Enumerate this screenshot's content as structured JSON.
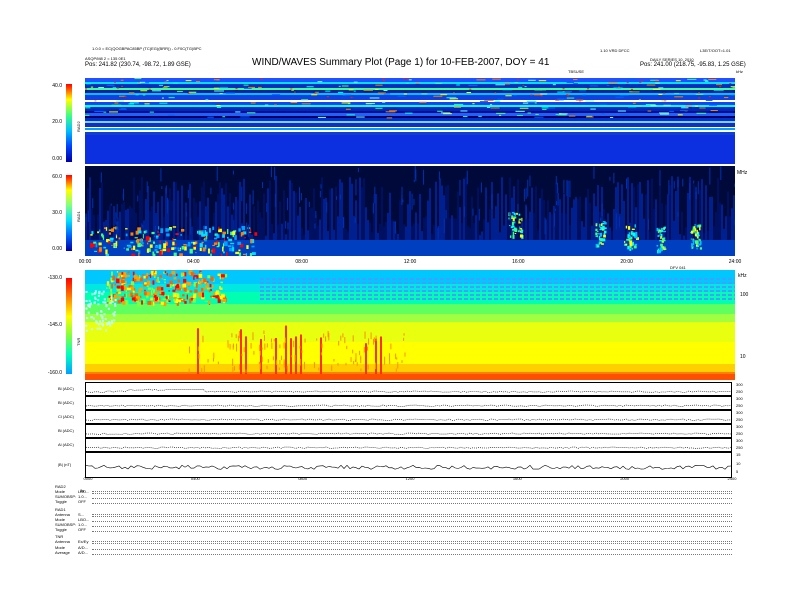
{
  "header": {
    "left_line1": "1.0.0 = EC(QOGBPAC85BP (TC(EG)(BRR)) - 0.F0C(TG)BPC",
    "left_line2": "ASQP/M8 2 = 135 0E1",
    "left_line3": "Pos: 241.82 (230.74, -98.72, 1.89 GSE)",
    "title": "WIND/WAVES Summary Plot (Page 1) for 10-FEB-2007, DOY = 41",
    "right_line1": "1.10 VRD DFCC",
    "right_line1b": "L3E/T/OOT=1.01",
    "right_line2": "DAILY SERIES 10, 2010",
    "right_line3": "Pos: 241.00 (218.75, -95.83, 1.25 GSE)",
    "top_unit_mid": "TBSUSE",
    "top_unit_right": "kHz"
  },
  "panels": {
    "rad2": {
      "label": "RAD2",
      "ticks": [
        "40.0",
        "20.0",
        "0.00"
      ]
    },
    "rad1": {
      "label": "RAD1",
      "ticks": [
        "60.0",
        "30.0",
        "0.00"
      ],
      "right_unit": "MHz"
    },
    "tnr": {
      "label": "TNR",
      "ticks": [
        "-130.0",
        "-145.0",
        "-160.0"
      ],
      "right_ticks": [
        "100",
        "10"
      ],
      "right_unit": "kHz"
    }
  },
  "mid_axis": [
    "00:00",
    "04:00",
    "08:00",
    "12:00",
    "16:00",
    "20:00",
    "24:00"
  ],
  "mid_axis_unit": "DFV 041",
  "bottom_axis": [
    "0000",
    "0400",
    "0800",
    "1200",
    "1600",
    "2000",
    "2400"
  ],
  "strips": [
    {
      "label": "Bl (ADC)",
      "right": [
        "300",
        "250"
      ]
    },
    {
      "label": "Bl (ADC)",
      "right": [
        "300",
        "250"
      ]
    },
    {
      "label": "Cl (ADC)",
      "right": [
        "300",
        "250"
      ]
    },
    {
      "label": "Bl (ADC)",
      "right": [
        "300",
        "250"
      ]
    },
    {
      "label": "Al (ADC)",
      "right": [
        "300",
        "250"
      ]
    },
    {
      "label": "|B| (nT)",
      "right": [
        "15",
        "10",
        "5"
      ]
    }
  ],
  "info_blocks": [
    {
      "title": "RAD2",
      "rows": [
        [
          "Mode",
          "LBO..."
        ],
        [
          "SUMOBSP:",
          "1.0..."
        ],
        [
          "Toggle",
          "OFF"
        ]
      ],
      "first": "8s"
    },
    {
      "title": "RAD1",
      "rows": [
        [
          "Antenna",
          "S..."
        ],
        [
          "Mode",
          "LBO..."
        ],
        [
          "SUMOBSP:",
          "1.0..."
        ],
        [
          "Toggle",
          "OFF"
        ]
      ],
      "first": ""
    },
    {
      "title": "TNR",
      "rows": [
        [
          "Antenna",
          "Ex/Ey"
        ],
        [
          "Mode",
          "A/D..."
        ],
        [
          "Average",
          "A/D..."
        ]
      ],
      "first": ""
    }
  ],
  "chart_data": [
    {
      "type": "heatmap",
      "title": "RAD2",
      "xlabel": "",
      "ylabel": "RAD2",
      "x_range_hours": [
        0,
        24
      ],
      "colorbar_ticks": [
        40.0,
        20.0,
        0.0
      ],
      "colormap": [
        "#0000a0",
        "#0040ff",
        "#00c0ff",
        "#40ff80",
        "#ffff00",
        "#ff8000",
        "#ff0000"
      ]
    },
    {
      "type": "heatmap",
      "title": "RAD1",
      "ylabel": "RAD1",
      "x_range_hours": [
        0,
        24
      ],
      "colorbar_ticks": [
        60.0,
        30.0,
        0.0
      ],
      "colormap": [
        "#000020",
        "#0000a0",
        "#0060ff",
        "#00e0ff",
        "#80ff80",
        "#ffff00",
        "#ff0000"
      ]
    },
    {
      "type": "heatmap",
      "title": "TNR",
      "ylabel": "TNR",
      "x_range_hours": [
        0,
        24
      ],
      "colorbar_ticks": [
        -130.0,
        -145.0,
        -160.0
      ],
      "colormap": [
        "#ff0000",
        "#ff8000",
        "#ffff00",
        "#80ff40",
        "#00ffc0",
        "#00a0ff"
      ]
    }
  ],
  "colors": {
    "rad2_bg": "#0a2ee0",
    "rad1_bg": "#000a3a",
    "tnr_top": "#00c8ff",
    "tnr_mid": "#60ff60",
    "tnr_low": "#ffff00",
    "tnr_bottom": "#ff6000"
  }
}
